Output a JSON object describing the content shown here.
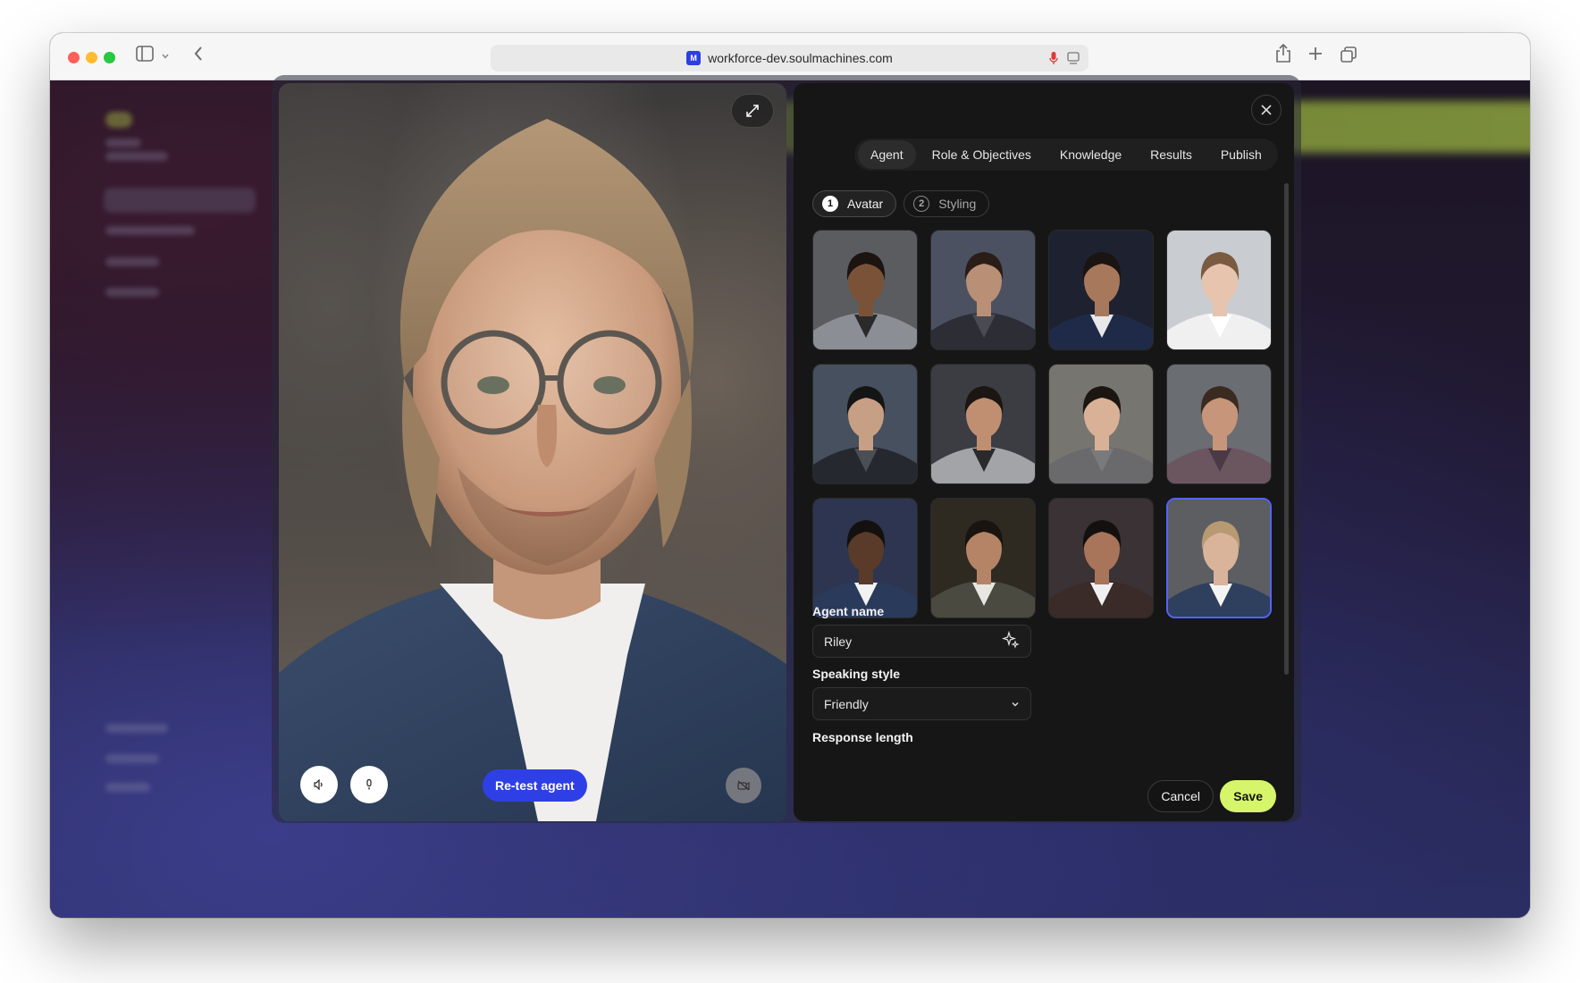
{
  "browser": {
    "url": "workforce-dev.soulmachines.com",
    "favicon_letter": "M"
  },
  "tabs": [
    {
      "label": "Agent",
      "active": true
    },
    {
      "label": "Role & Objectives",
      "active": false
    },
    {
      "label": "Knowledge",
      "active": false
    },
    {
      "label": "Results",
      "active": false
    },
    {
      "label": "Publish",
      "active": false
    }
  ],
  "steps": [
    {
      "number": "1",
      "label": "Avatar",
      "active": true
    },
    {
      "number": "2",
      "label": "Styling",
      "active": false
    }
  ],
  "avatars": [
    {
      "name": "avatar-1",
      "skin": "#7a5238",
      "hair": "#1c1410",
      "jacket": "#8b8e94",
      "shirt": "#2a2a2a",
      "bg": "#5a5c60",
      "selected": false
    },
    {
      "name": "avatar-2",
      "skin": "#b98f75",
      "hair": "#2a1d18",
      "jacket": "#2c2d35",
      "shirt": "#4a4a52",
      "bg": "#4b5160",
      "selected": false
    },
    {
      "name": "avatar-3",
      "skin": "#a8785d",
      "hair": "#1a1412",
      "jacket": "#1f2a48",
      "shirt": "#e8e8ea",
      "bg": "#1e2230",
      "selected": false
    },
    {
      "name": "avatar-4",
      "skin": "#e6c4ae",
      "hair": "#7a5a40",
      "jacket": "#f0f0f0",
      "shirt": "#ffffff",
      "bg": "#c9ccd0",
      "selected": false
    },
    {
      "name": "avatar-5",
      "skin": "#c79f84",
      "hair": "#151515",
      "jacket": "#25282e",
      "shirt": "#4a4f56",
      "bg": "#46505e",
      "selected": false
    },
    {
      "name": "avatar-6",
      "skin": "#c08f72",
      "hair": "#1c1612",
      "jacket": "#a2a4a8",
      "shirt": "#2a2a2a",
      "bg": "#3b3d42",
      "selected": false
    },
    {
      "name": "avatar-7",
      "skin": "#d9b196",
      "hair": "#1c1612",
      "jacket": "#6a6a6c",
      "shirt": "#7a7a7c",
      "bg": "#77756f",
      "selected": false
    },
    {
      "name": "avatar-8",
      "skin": "#c6957a",
      "hair": "#3a2a20",
      "jacket": "#6b5660",
      "shirt": "#4a3a45",
      "bg": "#6a6d72",
      "selected": false
    },
    {
      "name": "avatar-9",
      "skin": "#5a3a28",
      "hair": "#141010",
      "jacket": "#2a3a5a",
      "shirt": "#f2f2f2",
      "bg": "#2d3550",
      "selected": false
    },
    {
      "name": "avatar-10",
      "skin": "#b58466",
      "hair": "#1a1410",
      "jacket": "#4a4a40",
      "shirt": "#e8e6e0",
      "bg": "#2e2a22",
      "selected": false
    },
    {
      "name": "avatar-11",
      "skin": "#a8745a",
      "hair": "#141010",
      "jacket": "#3a2a28",
      "shirt": "#f0f0f0",
      "bg": "#3a3234",
      "selected": false
    },
    {
      "name": "avatar-12",
      "skin": "#d9b39a",
      "hair": "#b89a72",
      "jacket": "#2f3f5e",
      "shirt": "#f4f4f4",
      "bg": "#5c5e62",
      "selected": true
    }
  ],
  "form": {
    "agent_name_label": "Agent name",
    "agent_name_value": "Riley",
    "speaking_style_label": "Speaking style",
    "speaking_style_value": "Friendly",
    "response_length_label": "Response length"
  },
  "buttons": {
    "retest": "Re-test agent",
    "cancel": "Cancel",
    "save": "Save"
  },
  "colors": {
    "accent_blue": "#2f3fe6",
    "save_green": "#d7f56b",
    "selected_border": "#5563ff"
  }
}
